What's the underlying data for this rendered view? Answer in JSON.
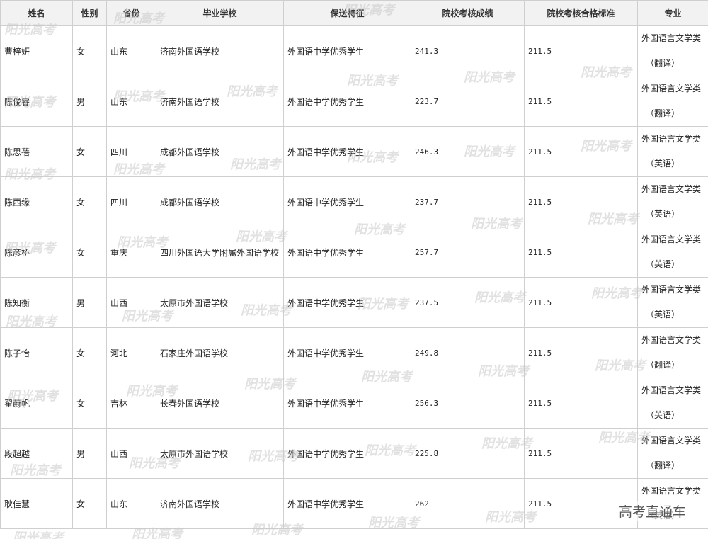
{
  "headers": [
    "姓名",
    "性别",
    "省份",
    "毕业学校",
    "保送特征",
    "院校考核成绩",
    "院校考核合格标准",
    "专业"
  ],
  "rows": [
    {
      "name": "曹梓妍",
      "gender": "女",
      "province": "山东",
      "school": "济南外国语学校",
      "feature": "外国语中学优秀学生",
      "score": "241.3",
      "standard": "211.5",
      "major": "外国语言文学类",
      "major_sub": "（翻译）"
    },
    {
      "name": "陈俊睿",
      "gender": "男",
      "province": "山东",
      "school": "济南外国语学校",
      "feature": "外国语中学优秀学生",
      "score": "223.7",
      "standard": "211.5",
      "major": "外国语言文学类",
      "major_sub": "（翻译）"
    },
    {
      "name": "陈思蓓",
      "gender": "女",
      "province": "四川",
      "school": "成都外国语学校",
      "feature": "外国语中学优秀学生",
      "score": "246.3",
      "standard": "211.5",
      "major": "外国语言文学类",
      "major_sub": "（英语）"
    },
    {
      "name": "陈西缘",
      "gender": "女",
      "province": "四川",
      "school": "成都外国语学校",
      "feature": "外国语中学优秀学生",
      "score": "237.7",
      "standard": "211.5",
      "major": "外国语言文学类",
      "major_sub": "（英语）"
    },
    {
      "name": "陈彦桥",
      "gender": "女",
      "province": "重庆",
      "school": "四川外国语大学附属外国语学校",
      "feature": "外国语中学优秀学生",
      "score": "257.7",
      "standard": "211.5",
      "major": "外国语言文学类",
      "major_sub": "（英语）"
    },
    {
      "name": "陈知衡",
      "gender": "男",
      "province": "山西",
      "school": "太原市外国语学校",
      "feature": "外国语中学优秀学生",
      "score": "237.5",
      "standard": "211.5",
      "major": "外国语言文学类",
      "major_sub": "（英语）"
    },
    {
      "name": "陈子怡",
      "gender": "女",
      "province": "河北",
      "school": "石家庄外国语学校",
      "feature": "外国语中学优秀学生",
      "score": "249.8",
      "standard": "211.5",
      "major": "外国语言文学类",
      "major_sub": "（翻译）"
    },
    {
      "name": "翟蔚帆",
      "gender": "女",
      "province": "吉林",
      "school": "长春外国语学校",
      "feature": "外国语中学优秀学生",
      "score": "256.3",
      "standard": "211.5",
      "major": "外国语言文学类",
      "major_sub": "（英语）"
    },
    {
      "name": "段超越",
      "gender": "男",
      "province": "山西",
      "school": "太原市外国语学校",
      "feature": "外国语中学优秀学生",
      "score": "225.8",
      "standard": "211.5",
      "major": "外国语言文学类",
      "major_sub": "（翻译）"
    },
    {
      "name": "耿佳慧",
      "gender": "女",
      "province": "山东",
      "school": "济南外国语学校",
      "feature": "外国语中学优秀学生",
      "score": "262",
      "standard": "211.5",
      "major": "外国语言文学类",
      "major_sub": "（英语）"
    }
  ],
  "watermark_text": "阳光高考",
  "logo_text": "高考直通车"
}
